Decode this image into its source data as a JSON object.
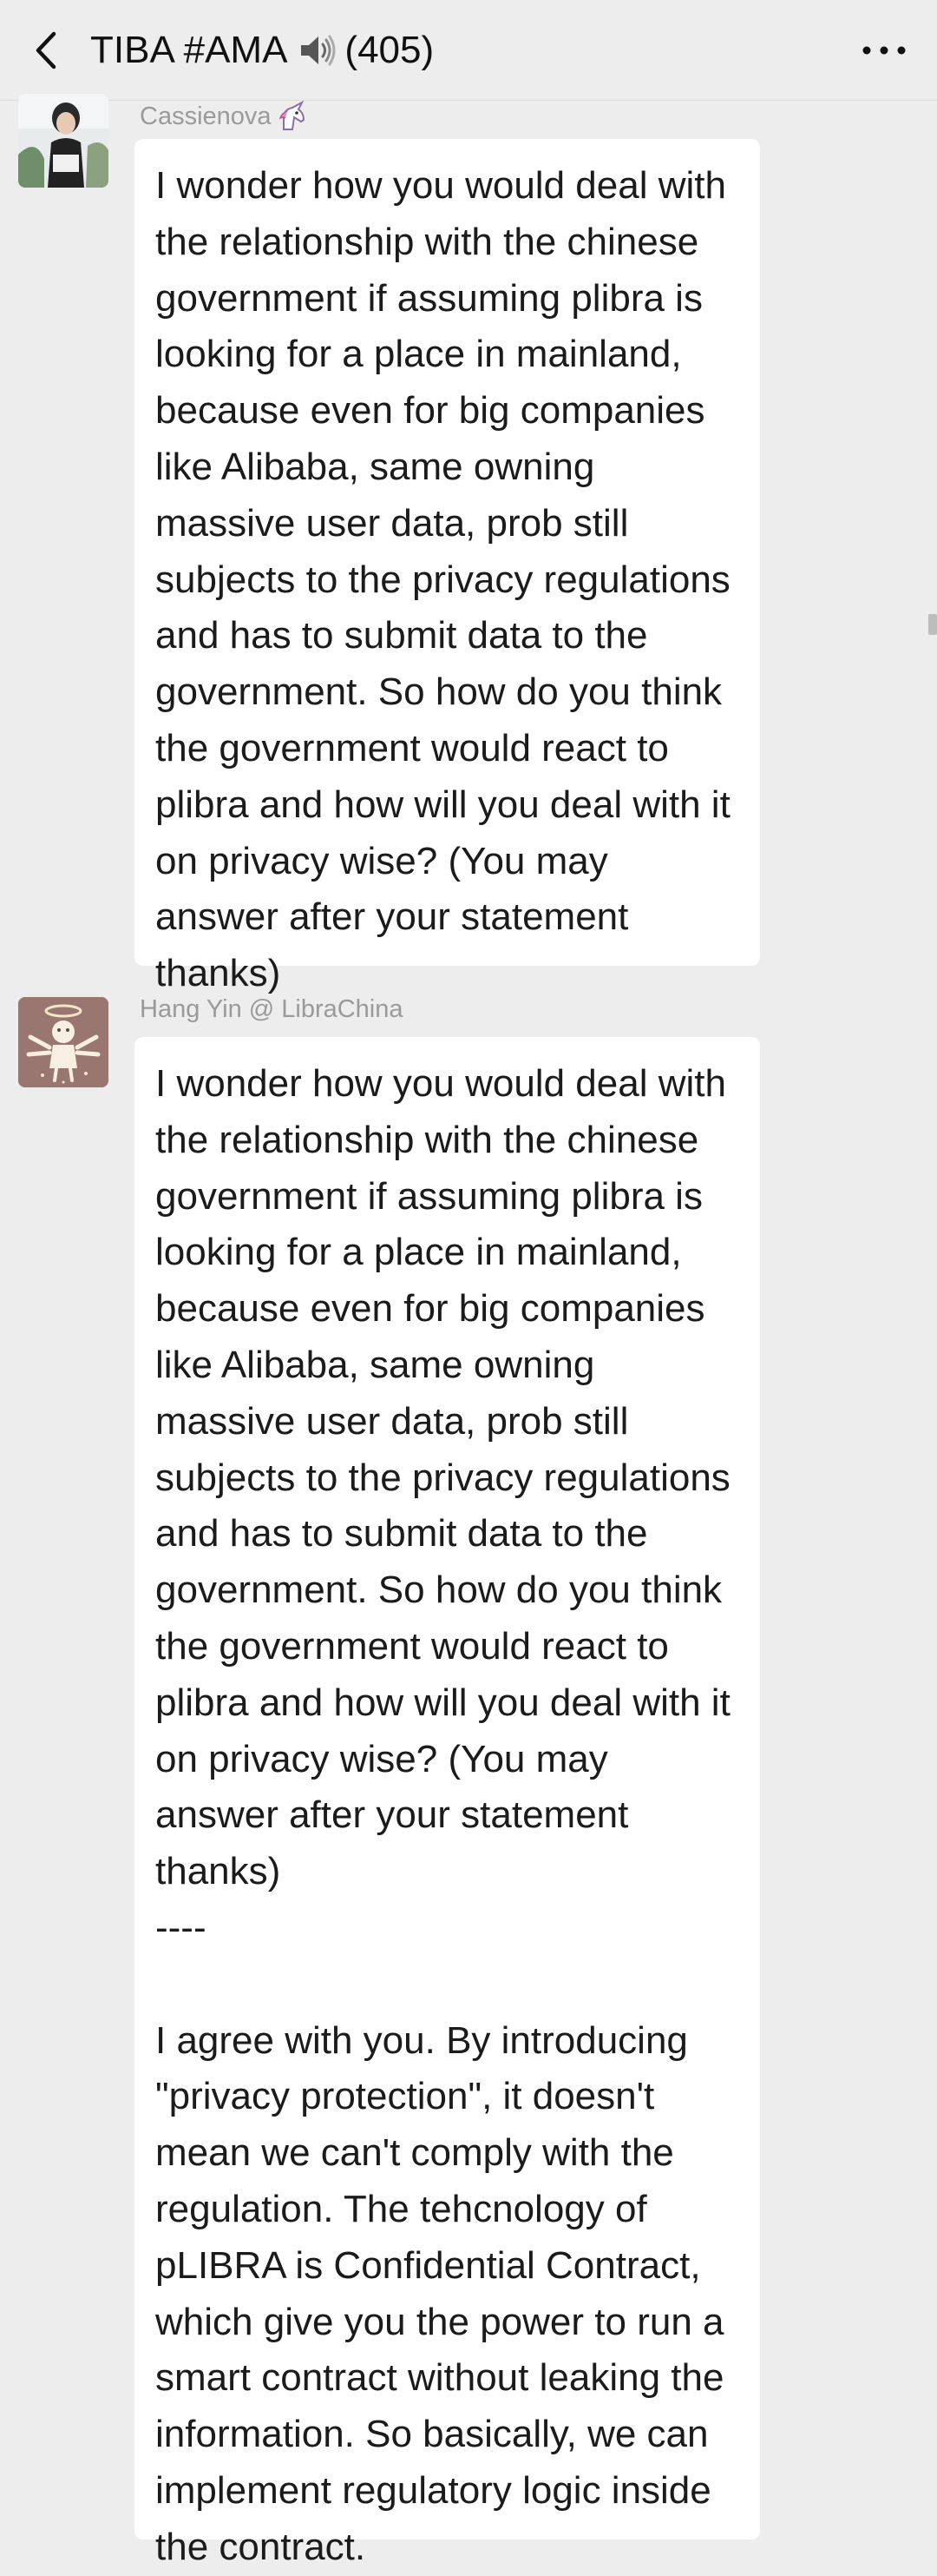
{
  "header": {
    "title": "TIBA #AMA",
    "count": "(405)",
    "back_icon": "chevron-left-icon",
    "speaker_icon": "speaker-icon",
    "more_icon": "more-icon"
  },
  "messages": [
    {
      "sender": "Cassienova",
      "sender_badge_icon": "unicorn-icon",
      "avatar_icon": "avatar-photo",
      "text": "I wonder how you would deal with the relationship with the chinese government if assuming plibra is looking for a place in mainland, because even for big companies like Alibaba, same owning massive user data, prob still subjects to the privacy regulations and has to submit data to the government. So how do you think the government would react to plibra and how will you deal with it on privacy wise? (You may answer after your statement thanks)"
    },
    {
      "sender": "Hang Yin @ LibraChina",
      "avatar_icon": "angel-avatar",
      "text": "I wonder how you would deal with the relationship with the chinese government if assuming plibra is looking for a place in mainland, because even for big companies like Alibaba, same owning massive user data, prob still subjects to the privacy regulations and has to submit data to the government. So how do you think the government would react to plibra and how will you deal with it on privacy wise? (You may answer after your statement thanks)\n----\n\nI agree with you. By introducing \"privacy protection\", it doesn't mean we can't comply with the regulation. The tehcnology of pLIBRA is Confidential Contract, which give you the power to run a smart contract without leaking the information. So basically, we can implement regulatory logic inside the contract."
    }
  ]
}
